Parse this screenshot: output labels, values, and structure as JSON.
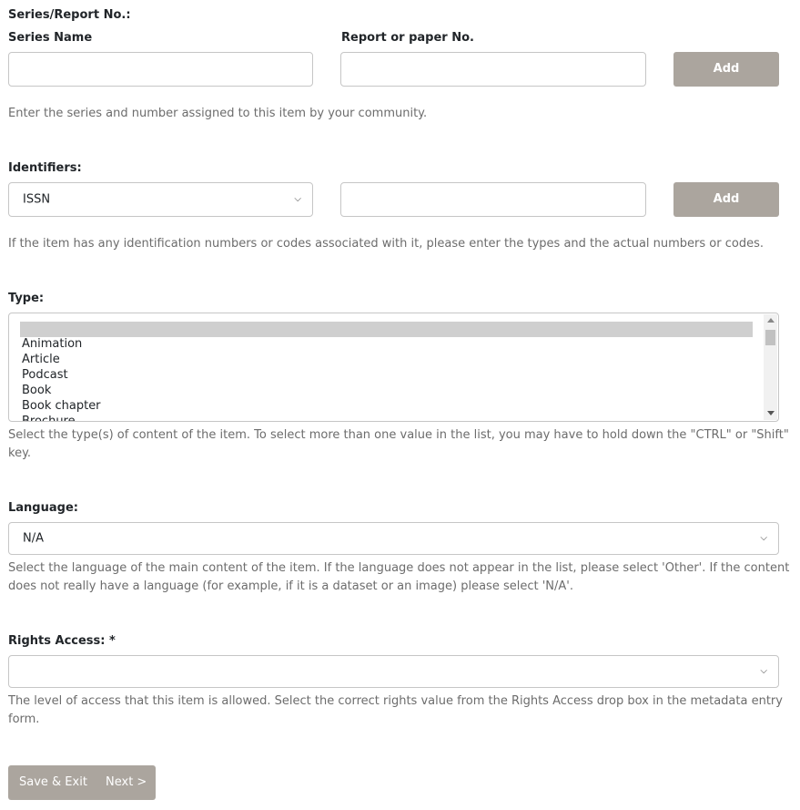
{
  "series": {
    "heading": "Series/Report No.:",
    "name_label": "Series Name",
    "number_label": "Report or paper No.",
    "name_value": "",
    "number_value": "",
    "add_label": "Add",
    "help": "Enter the series and number assigned to this item by your community."
  },
  "identifiers": {
    "heading": "Identifiers:",
    "type_value": "ISSN",
    "id_value": "",
    "add_label": "Add",
    "help": "If the item has any identification numbers or codes associated with it, please enter the types and the actual numbers or codes."
  },
  "type": {
    "heading": "Type:",
    "options": [
      "",
      "Animation",
      "Article",
      "Podcast",
      "Book",
      "Book chapter",
      "Brochure"
    ],
    "selected_index": 0,
    "help_line1": "Select the type(s) of content of the item. To select more than one value in the list, you may have to hold down the \"CTRL\" or \"Shift\"",
    "help_line2": "key."
  },
  "language": {
    "heading": "Language:",
    "value": "N/A",
    "help_line1": "Select the language of the main content of the item. If the language does not appear in the list, please select 'Other'. If the content",
    "help_line2": "does not really have a language (for example, if it is a dataset or an image) please select 'N/A'."
  },
  "rights": {
    "heading": "Rights Access: *",
    "value": "",
    "help_line1": "The level of access that this item is allowed. Select the correct rights value from the Rights Access drop box in the metadata entry",
    "help_line2": "form."
  },
  "footer": {
    "save_exit": "Save & Exit",
    "next": "Next >"
  }
}
